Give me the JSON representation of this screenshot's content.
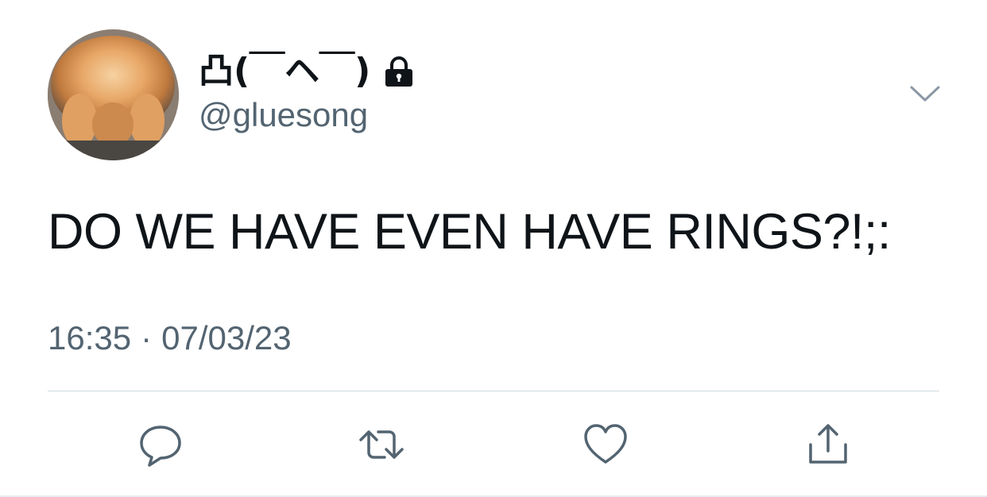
{
  "user": {
    "display_name": "凸(￣ヘ￣)",
    "handle": "@gluesong",
    "protected_icon": "lock-icon"
  },
  "tweet": {
    "text": "DO WE HAVE EVEN HAVE RINGS?!;:",
    "time": "16:35",
    "separator": "·",
    "date": "07/03/23"
  },
  "actions": {
    "reply_icon": "reply-icon",
    "retweet_icon": "retweet-icon",
    "like_icon": "heart-icon",
    "share_icon": "share-icon"
  },
  "colors": {
    "text_primary": "#0f1419",
    "text_secondary": "#536471",
    "divider": "#cfd9de"
  }
}
